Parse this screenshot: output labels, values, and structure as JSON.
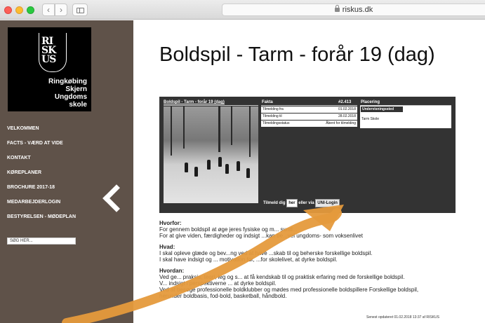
{
  "browser": {
    "url": "riskus.dk",
    "back_icon": "chevron-left-icon",
    "forward_icon": "chevron-right-icon",
    "back_glyph": "‹",
    "forward_glyph": "›"
  },
  "logo": {
    "seal_text": [
      "RI",
      "SK",
      "US"
    ],
    "name_lines": [
      "Ringkøbing",
      "Skjern",
      "Ungdoms",
      "skole"
    ]
  },
  "sidebar": {
    "items": [
      {
        "label": "VELKOMMEN"
      },
      {
        "label": "FACTS - VÆRD AT VIDE"
      },
      {
        "label": "KONTAKT"
      },
      {
        "label": "KØREPLANER"
      },
      {
        "label": "BROCHURE 2017-18"
      },
      {
        "label": "MEDARBEJDERLOGIN"
      },
      {
        "label": "BESTYRELSEN - MØDEPLAN"
      }
    ],
    "search_placeholder": "SØG HER...",
    "back_icon": "chevron-left-icon"
  },
  "page": {
    "title": "Boldspil - Tarm - forår 19 (dag)"
  },
  "panel": {
    "photo_caption": "Boldspil - Tarm - forår 19 (dag)",
    "facts_header": "Fakta",
    "facts_id": "#2.413",
    "facts": [
      {
        "label": "Tilmelding fra",
        "value": "01.02.2018"
      },
      {
        "label": "Tilmelding til",
        "value": "28.02.2018"
      },
      {
        "label": "Tilmeldingsstatus",
        "value": "Åbent for tilmelding"
      }
    ],
    "placement_header": "Placering",
    "placement_tab": "Undervisningssted",
    "placement_value": "Tarm Skole",
    "signup_prefix": "Tilmeld dig",
    "signup_here": "her",
    "signup_middle": "eller via",
    "signup_unilogin": "UNI-Login"
  },
  "content": {
    "hvorfor_heading": "Hvorfor:",
    "hvorfor_lines": [
      "For gennem boldspil at øge jeres fysiske og m... sund...",
      "For at give viden, færdigheder og indsigt ...kan be...vel ungdoms- som voksenlivet"
    ],
    "hvad_heading": "Hvad:",
    "hvad_lines": [
      "I skal opleve glæde og bev...ng ved at have ...skab til og beherske forskellige boldspil.",
      "I skal have indsigt og ... motivation for, ...for skolelivet, at dyrke boldspil."
    ],
    "hvordan_heading": "Hvordan:",
    "hvordan_lines": [
      "Ved ge... praksis, teori, leg og s... at få kendskab til og praktisk erfaring med de forskellige boldspil.",
      "V... indsigt i perspektiverne ... at dyrke boldspil.",
      "Ved at besøge professionelle boldklubber og mødes med professionelle boldspillere Forskellige boldspil,",
      "herunder boldbasis, fod-bold, basketball, håndbold."
    ],
    "updated": "Senest opdateret 01.02.2018 13:37 af RISKUS"
  },
  "colors": {
    "sidebar_bg": "#5f5249",
    "panel_bg": "#333333",
    "arrow": "#e59a3c"
  },
  "overlay": {
    "arrow_icon": "annotation-arrow"
  }
}
